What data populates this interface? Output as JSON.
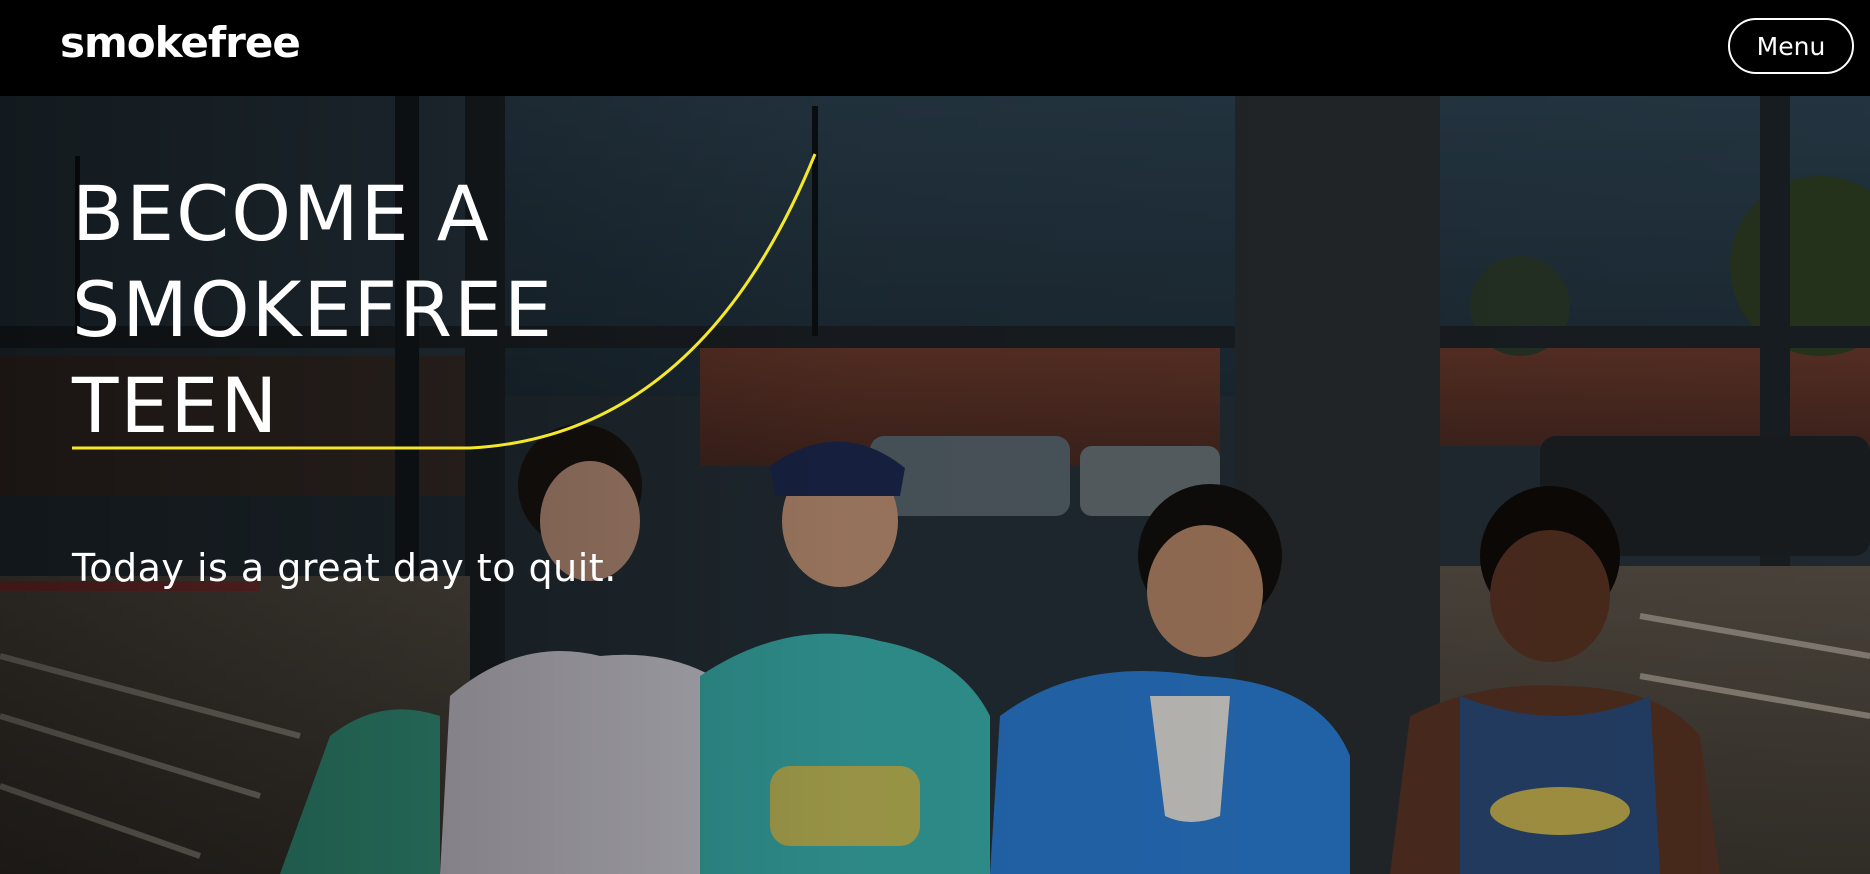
{
  "header": {
    "logo": "smokefree",
    "menu_label": "Menu"
  },
  "hero": {
    "headline_lines": [
      "BECOME A",
      "SMOKEFREE",
      "TEEN"
    ],
    "tagline": "Today is a great day to quit.",
    "image_icon": "photo-teens-group-icon"
  },
  "colors": {
    "header_bg": "#000000",
    "text": "#ffffff",
    "accent_line": "#f5e82a"
  }
}
